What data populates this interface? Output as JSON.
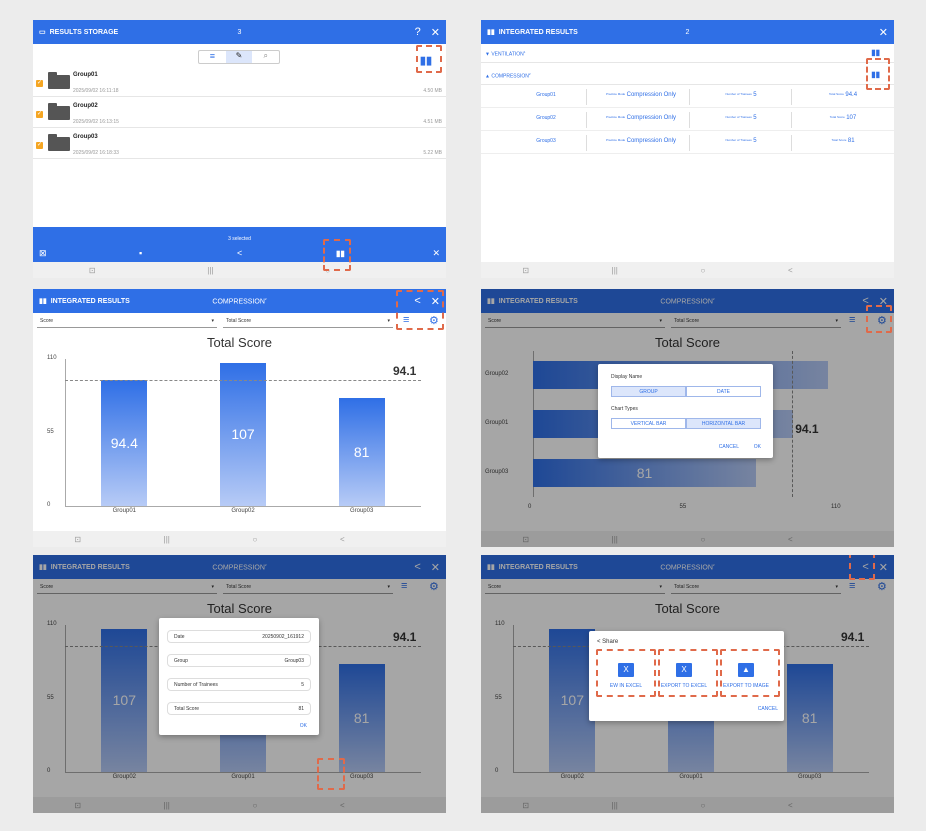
{
  "p1": {
    "title": "RESULTS STORAGE",
    "count": "3",
    "groups": [
      {
        "name": "Group01",
        "date": "2025/09/02 16:11:18",
        "size": "4.50 MB"
      },
      {
        "name": "Group02",
        "date": "2025/09/02 16:13:15",
        "size": "4.51 MB"
      },
      {
        "name": "Group03",
        "date": "2025/09/02 16:18:33",
        "size": "5.22 MB"
      }
    ],
    "selected": "3 selected"
  },
  "p2": {
    "title": "INTEGRATED RESULTS",
    "count": "2",
    "ventilation": "VENTILATION",
    "ventilation_sup": "1",
    "compression": "COMPRESSION",
    "compression_sup": "2",
    "practice_mode_label": "Practice Mode",
    "trainees_label": "Number of Trainees",
    "total_score_label": "Total Score",
    "rows": [
      {
        "group": "Group01",
        "mode": "Compression Only",
        "trainees": "5",
        "score": "94.4"
      },
      {
        "group": "Group02",
        "mode": "Compression Only",
        "trainees": "5",
        "score": "107"
      },
      {
        "group": "Group03",
        "mode": "Compression Only",
        "trainees": "5",
        "score": "81"
      }
    ]
  },
  "common": {
    "title": "INTEGRATED RESULTS",
    "mode": "COMPRESSION",
    "mode_sup": "2",
    "select_left": "Score",
    "select_right": "Total Score",
    "chart_title": "Total Score",
    "average": "94.1"
  },
  "dialog_display": {
    "display_name": "Display Name",
    "group": "GROUP",
    "date": "DATE",
    "chart_types": "Chart Types",
    "vertical": "VERTICAL BAR",
    "horizontal": "HORIZONTAL BAR",
    "cancel": "CANCEL",
    "ok": "OK"
  },
  "dialog_info": {
    "date_label": "Date",
    "date_value": "20250902_161912",
    "group_label": "Group",
    "group_value": "Group03",
    "trainees_label": "Number of Trainees",
    "trainees_value": "5",
    "score_label": "Total Score",
    "score_value": "81",
    "ok": "OK"
  },
  "dialog_share": {
    "title": "Share",
    "view": "EW IN EXCEL",
    "export_excel": "EXPORT TO EXCEL",
    "export_image": "EXPORT TO IMAGE",
    "cancel": "CANCEL"
  },
  "chart_data": [
    {
      "type": "bar",
      "title": "Total Score",
      "categories": [
        "Group01",
        "Group02",
        "Group03"
      ],
      "values": [
        94.4,
        107,
        81
      ],
      "ylim": [
        0,
        110
      ],
      "yticks": [
        0,
        55,
        110
      ],
      "average": 94.1
    },
    {
      "type": "bar",
      "orientation": "horizontal",
      "title": "Total Score",
      "categories": [
        "Group02",
        "Group01",
        "Group03"
      ],
      "values": [
        107,
        94.4,
        81
      ],
      "xlim": [
        0,
        110
      ],
      "xticks": [
        0,
        55,
        110
      ],
      "average": 94.1
    },
    {
      "type": "bar",
      "title": "Total Score",
      "categories": [
        "Group02",
        "Group01",
        "Group03"
      ],
      "values": [
        107,
        94.4,
        81
      ],
      "ylim": [
        0,
        110
      ],
      "yticks": [
        0,
        55,
        110
      ],
      "average": 94.1
    }
  ]
}
